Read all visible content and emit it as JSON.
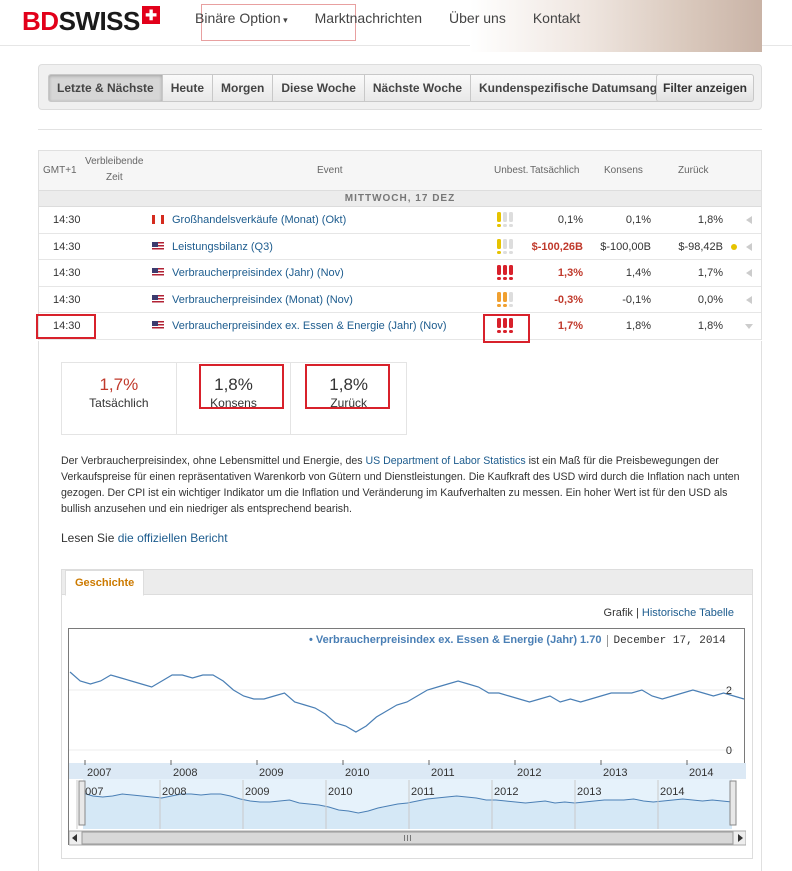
{
  "brand": {
    "part1": "BD",
    "part2": "SWISS"
  },
  "nav": [
    "Binäre Option",
    "Marktnachrichten",
    "Über uns",
    "Kontakt"
  ],
  "filters": {
    "tabs": [
      "Letzte & Nächste",
      "Heute",
      "Morgen",
      "Diese Woche",
      "Nächste Woche",
      "Kundenspezifische Datumsangaben..."
    ],
    "active": "Letzte & Nächste",
    "button": "Filter anzeigen"
  },
  "calendar": {
    "headers": {
      "timezone": "GMT+1",
      "remaining_line1": "Verbleibende",
      "remaining_line2": "Zeit",
      "event": "Event",
      "unbest": "Unbest.",
      "actual": "Tatsächlich",
      "consensus": "Konsens",
      "previous": "Zurück"
    },
    "day": "MITTWOCH, 17 DEZ",
    "rows": [
      {
        "time": "14:30",
        "country": "CA",
        "event": "Großhandelsverkäufe (Monat) (Okt)",
        "impact": 1,
        "actual": "0,1%",
        "consensus": "0,1%",
        "previous": "1,8%"
      },
      {
        "time": "14:30",
        "country": "US",
        "event": "Leistungsbilanz (Q3)",
        "impact": 1,
        "actual": "$-100,26B",
        "consensus": "$-100,00B",
        "previous": "$-98,42B"
      },
      {
        "time": "14:30",
        "country": "US",
        "event": "Verbraucherpreisindex (Jahr) (Nov)",
        "impact": 3,
        "actual": "1,3%",
        "consensus": "1,4%",
        "previous": "1,7%"
      },
      {
        "time": "14:30",
        "country": "US",
        "event": "Verbraucherpreisindex (Monat) (Nov)",
        "impact": 2,
        "actual": "-0,3%",
        "consensus": "-0,1%",
        "previous": "0,0%"
      },
      {
        "time": "14:30",
        "country": "US",
        "event": "Verbraucherpreisindex ex. Essen & Energie (Jahr) (Nov)",
        "impact": 3,
        "actual": "1,7%",
        "consensus": "1,8%",
        "previous": "1,8%"
      }
    ]
  },
  "detail": {
    "actual_value": "1,7%",
    "actual_label": "Tatsächlich",
    "consensus_value": "1,8%",
    "consensus_label": "Konsens",
    "previous_value": "1,8%",
    "previous_label": "Zurück",
    "desc_pre": "Der Verbraucherpreisindex, ohne Lebensmittel und Energie, des ",
    "desc_link": "US Department of Labor Statistics",
    "desc_post": " ist ein Maß für die Preisbewegungen der Verkaufspreise für einen repräsentativen Warenkorb von Gütern und Dienstleistungen. Die Kaufkraft des USD wird durch die Inflation nach unten gezogen. Der CPI ist ein wichtiger Indikator um die Inflation und Veränderung im Kaufverhalten zu messen. Ein hoher Wert ist für den USD als bullish anzusehen und ein niedriger als entsprechend bearish.",
    "read_pre": "Lesen Sie ",
    "read_link": "die offiziellen Bericht",
    "history_tab": "Geschichte",
    "grafik": "Grafik",
    "grafik_sep": "|",
    "table_link": "Historische Tabelle"
  },
  "chart_data": {
    "type": "line",
    "title": "Verbraucherpreisindex ex. Essen & Energie (Jahr)",
    "legend_value": "1.70",
    "legend_date": "December 17, 2014",
    "yticks": [
      "2",
      "0"
    ],
    "years": [
      "2007",
      "2008",
      "2009",
      "2010",
      "2011",
      "2012",
      "2013",
      "2014"
    ],
    "series": [
      {
        "values": [
          2.6,
          2.3,
          2.2,
          2.3,
          2.5,
          2.4,
          2.3,
          2.2,
          2.1,
          2.3,
          2.5,
          2.5,
          2.4,
          2.5,
          2.5,
          2.3,
          2.0,
          1.8,
          1.7,
          1.7,
          1.8,
          1.9,
          1.6,
          1.5,
          1.4,
          1.2,
          0.9,
          0.8,
          0.6,
          0.8,
          1.1,
          1.3,
          1.5,
          1.6,
          1.8,
          2.0,
          2.1,
          2.2,
          2.3,
          2.2,
          2.1,
          1.9,
          1.9,
          1.8,
          1.7,
          1.6,
          1.7,
          1.8,
          1.6,
          1.7,
          1.6,
          1.7,
          1.8,
          1.9,
          1.9,
          1.9,
          2.0,
          1.8,
          1.7,
          1.8,
          1.9,
          2.0,
          1.9,
          1.8,
          1.9,
          1.8,
          1.7
        ]
      }
    ]
  }
}
